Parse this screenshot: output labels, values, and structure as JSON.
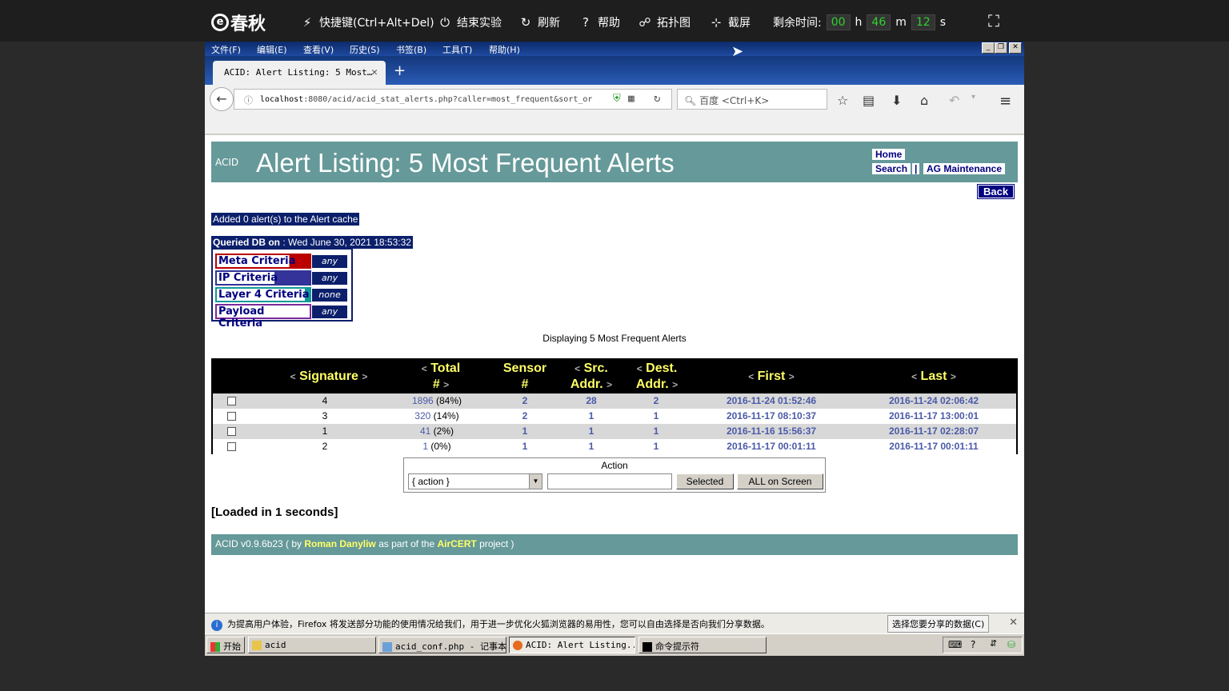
{
  "topbar": {
    "logo_mark": "e",
    "logo": "春秋",
    "shortcut": "快捷键(Ctrl+Alt+Del)",
    "end": "结束实验",
    "refresh": "刷新",
    "help": "帮助",
    "topology": "拓扑图",
    "screenshot": "截屏",
    "remaining": "剩余时间:",
    "h_val": "00",
    "h": "h",
    "m_val": "46",
    "m": "m",
    "s_val": "12",
    "s": "s"
  },
  "menu": {
    "file": "文件(F)",
    "edit": "编辑(E)",
    "view": "查看(V)",
    "history": "历史(S)",
    "bookmarks": "书签(B)",
    "tools": "工具(T)",
    "help": "帮助(H)"
  },
  "browser": {
    "tab_title": "ACID: Alert Listing: 5 Most…",
    "url_host": "localhost",
    "url_rest": ":8080/acid/acid_stat_alerts.php?caller=most_frequent&sort_or",
    "search_placeholder": "百度 <Ctrl+K>"
  },
  "page": {
    "acid_small": "ACID",
    "title": "Alert Listing: 5 Most Frequent Alerts",
    "home": "Home",
    "search": "Search",
    "sep": "|",
    "ag": "AG Maintenance",
    "back": "Back",
    "added": "Added 0 alert(s) to the Alert cache",
    "queried_label": "Queried DB on",
    "queried_value": " : Wed June 30, 2021 18:53:32",
    "criteria": [
      {
        "label": "Meta Criteria",
        "value": "any"
      },
      {
        "label": "IP Criteria",
        "value": "any"
      },
      {
        "label": "Layer 4 Criteria",
        "value": "none"
      },
      {
        "label": "Payload Criteria",
        "value": "any"
      }
    ],
    "displaying": "Displaying 5 Most Frequent Alerts",
    "headers": {
      "signature": "Signature",
      "total": "Total",
      "total2": "#",
      "sensor": "Sensor",
      "sensor2": "#",
      "src": "Src.",
      "src2": "Addr.",
      "dest": "Dest.",
      "dest2": "Addr.",
      "first": "First",
      "last": "Last",
      "lt": "<",
      "gt": ">"
    },
    "rows": [
      {
        "sig": "4",
        "total": "1896",
        "pct": "(84%)",
        "sensor": "2",
        "src": "28",
        "dest": "2",
        "first": "2016-11-24 01:52:46",
        "last": "2016-11-24 02:06:42"
      },
      {
        "sig": "3",
        "total": "320",
        "pct": "(14%)",
        "sensor": "2",
        "src": "1",
        "dest": "1",
        "first": "2016-11-17 08:10:37",
        "last": "2016-11-17 13:00:01"
      },
      {
        "sig": "1",
        "total": "41",
        "pct": "(2%)",
        "sensor": "1",
        "src": "1",
        "dest": "1",
        "first": "2016-11-16 15:56:37",
        "last": "2016-11-17 02:28:07"
      },
      {
        "sig": "2",
        "total": "1",
        "pct": "(0%)",
        "sensor": "1",
        "src": "1",
        "dest": "1",
        "first": "2016-11-17 00:01:11",
        "last": "2016-11-17 00:01:11"
      }
    ],
    "action_label": "Action",
    "action_select": "{ action }",
    "selected_btn": "Selected",
    "all_btn": "ALL on Screen",
    "loaded": "[Loaded in 1 seconds]",
    "footer_a": "ACID v0.9.6b23 ( by ",
    "footer_author": "Roman Danyliw",
    "footer_b": " as part of the ",
    "footer_proj": "AirCERT",
    "footer_c": " project )"
  },
  "notification": {
    "text": "为提高用户体验，Firefox 将发送部分功能的使用情况给我们，用于进一步优化火狐浏览器的易用性，您可以自由选择是否向我们分享数据。",
    "button": "选择您要分享的数据(C)"
  },
  "taskbar": {
    "start": "开始",
    "items": [
      "acid",
      "acid_conf.php - 记事本",
      "ACID: Alert Listing...",
      "命令提示符"
    ]
  },
  "colors": {
    "acid_teal": "#669999",
    "navy": "#0b1f6b",
    "link": "#4a5aa8",
    "header_text": "#ffff66"
  }
}
